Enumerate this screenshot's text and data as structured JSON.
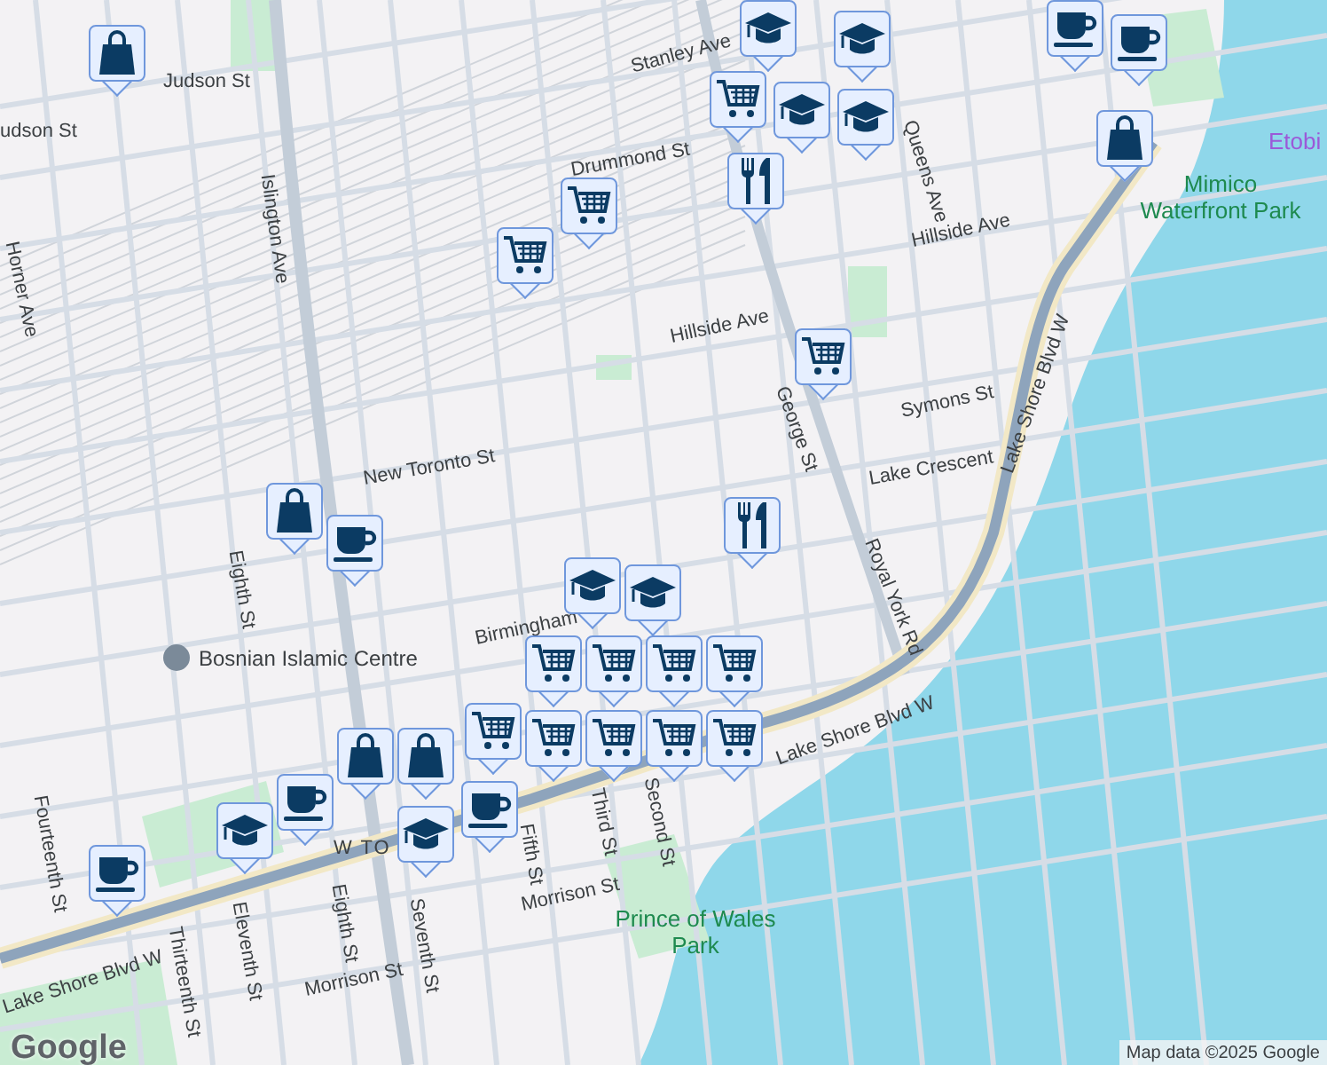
{
  "map": {
    "labels": [
      {
        "text": "Judson St",
        "kind": "street"
      },
      {
        "text": "udson St",
        "kind": "street"
      },
      {
        "text": "Drummond St",
        "kind": "street"
      },
      {
        "text": "Stanley Ave",
        "kind": "street"
      },
      {
        "text": "Queens Ave",
        "kind": "street"
      },
      {
        "text": "Hillside Ave",
        "kind": "street"
      },
      {
        "text": "Hillside Ave",
        "kind": "street"
      },
      {
        "text": "Islington Ave",
        "kind": "street"
      },
      {
        "text": "Horner Ave",
        "kind": "street"
      },
      {
        "text": "New Toronto St",
        "kind": "street"
      },
      {
        "text": "Symons St",
        "kind": "street"
      },
      {
        "text": "Lake Crescent",
        "kind": "street"
      },
      {
        "text": "Royal York Rd",
        "kind": "street"
      },
      {
        "text": "George St",
        "kind": "street"
      },
      {
        "text": "Lake Shore Blvd W",
        "kind": "street"
      },
      {
        "text": "Lake Shore Blvd W",
        "kind": "street"
      },
      {
        "text": "Lake Shore Blvd W",
        "kind": "street"
      },
      {
        "text": "Birmingham",
        "kind": "street"
      },
      {
        "text": "Bosnian Islamic Centre",
        "kind": "poi"
      },
      {
        "text": "Eighth St",
        "kind": "street"
      },
      {
        "text": "Eighth St",
        "kind": "street"
      },
      {
        "text": "Fourteenth St",
        "kind": "street"
      },
      {
        "text": "Thirteenth St",
        "kind": "street"
      },
      {
        "text": "Eleventh St",
        "kind": "street"
      },
      {
        "text": "Morrison St",
        "kind": "street"
      },
      {
        "text": "Morrison St",
        "kind": "street"
      },
      {
        "text": "Third St",
        "kind": "street"
      },
      {
        "text": "Second St",
        "kind": "street"
      },
      {
        "text": "Fifth St",
        "kind": "street"
      },
      {
        "text": "Seventh St",
        "kind": "street"
      },
      {
        "text": "W TO",
        "kind": "district"
      },
      {
        "text": "Prince of Wales Park",
        "kind": "park"
      },
      {
        "text": "Mimico Waterfront Park",
        "kind": "park"
      },
      {
        "text": "Etobi",
        "kind": "city"
      }
    ],
    "markers": [
      {
        "kind": "bag"
      },
      {
        "kind": "school"
      },
      {
        "kind": "cafe"
      },
      {
        "kind": "cafe"
      },
      {
        "kind": "school"
      },
      {
        "kind": "cart"
      },
      {
        "kind": "school"
      },
      {
        "kind": "school"
      },
      {
        "kind": "food"
      },
      {
        "kind": "bag"
      },
      {
        "kind": "cart"
      },
      {
        "kind": "cart"
      },
      {
        "kind": "cart"
      },
      {
        "kind": "bag"
      },
      {
        "kind": "cafe"
      },
      {
        "kind": "food"
      },
      {
        "kind": "school"
      },
      {
        "kind": "school"
      },
      {
        "kind": "cart"
      },
      {
        "kind": "cart"
      },
      {
        "kind": "cart"
      },
      {
        "kind": "cart"
      },
      {
        "kind": "cart"
      },
      {
        "kind": "cart"
      },
      {
        "kind": "cart"
      },
      {
        "kind": "cart"
      },
      {
        "kind": "cart"
      },
      {
        "kind": "bag"
      },
      {
        "kind": "bag"
      },
      {
        "kind": "cafe"
      },
      {
        "kind": "cafe"
      },
      {
        "kind": "school"
      },
      {
        "kind": "school"
      },
      {
        "kind": "cafe"
      }
    ]
  },
  "logo": "Google",
  "attribution": "Map data ©2025 Google"
}
